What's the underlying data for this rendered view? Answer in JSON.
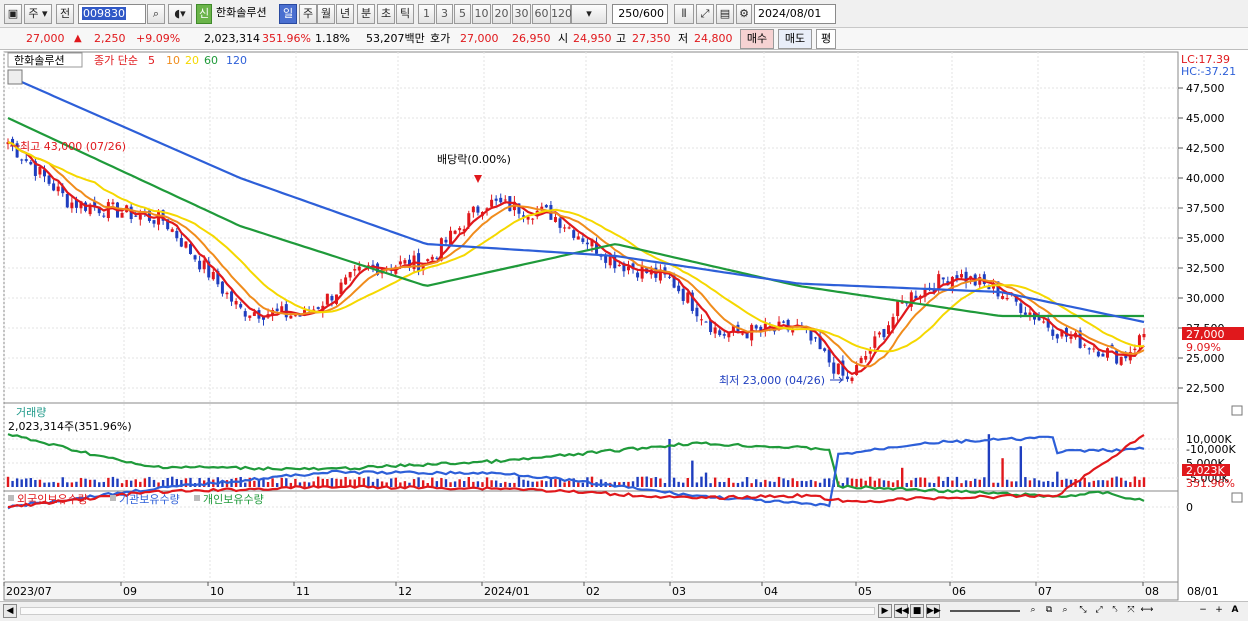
{
  "toolbar": {
    "period_type": "주",
    "prev_label": "전",
    "stock_code": "009830",
    "new_badge": "신",
    "stock_name": "한화솔루션",
    "periods": [
      "일",
      "주",
      "월",
      "년",
      "분",
      "초",
      "틱"
    ],
    "active_period": "일",
    "ranges": [
      "1",
      "3",
      "5",
      "10",
      "20",
      "30",
      "60",
      "120"
    ],
    "count_display": "250/600",
    "date": "2024/08/01"
  },
  "quote": {
    "price": "27,000",
    "arrow": "▲",
    "change": "2,250",
    "change_pct": "+9.09%",
    "volume": "2,023,314",
    "volume_ratio": "351.96%",
    "turnover": "1.18%",
    "amount": "53,207백만",
    "bid_label": "호가",
    "ask": "27,000",
    "bid": "26,950",
    "open_label": "시",
    "open": "24,950",
    "high_label": "고",
    "high": "27,350",
    "low_label": "저",
    "low": "24,800",
    "buy_label": "매수",
    "sell_label": "매도",
    "eval_label": "평"
  },
  "price_panel": {
    "legend_name": "한화솔루션",
    "legend_type": "종가 단순",
    "ma_labels": [
      "5",
      "10",
      "20",
      "60",
      "120"
    ],
    "ma_colors": [
      "#e0181c",
      "#f08c1c",
      "#f5d800",
      "#1f9a3a",
      "#2d5fd8"
    ],
    "lc": "LC:17.39",
    "hc": "HC:-37.21",
    "yaxis": [
      "47,500",
      "45,000",
      "42,500",
      "40,000",
      "37,500",
      "35,000",
      "32,500",
      "30,000",
      "27,500",
      "25,000",
      "22,500"
    ],
    "current_price_tag": "27,000",
    "current_pct_tag": "9.09%",
    "high_annotation": "최고 43,000 (07/26)",
    "low_annotation": "최저 23,000 (04/26)",
    "dividend_annotation": "배당락(0.00%)"
  },
  "volume_panel": {
    "title": "거래량",
    "value_text": "2,023,314주(351.96%)",
    "yaxis": [
      "10,000K",
      "5,000K"
    ],
    "current_tag": "2,023K",
    "pct_tag": "351.96%"
  },
  "holding_panel": {
    "legend": [
      "외국인보유수량",
      "기관보유수량",
      "개인보유수량"
    ],
    "legend_colors": [
      "#e0181c",
      "#2d5fd8",
      "#1f9a3a"
    ],
    "yaxis": [
      "0",
      "-5,000K",
      "-10,000K"
    ]
  },
  "xaxis": [
    "2023/07",
    "09",
    "10",
    "11",
    "12",
    "2024/01",
    "02",
    "03",
    "04",
    "05",
    "06",
    "07",
    "08",
    "08/01"
  ],
  "chart_data": {
    "type": "line",
    "title": "",
    "series": [
      {
        "name": "종가",
        "x": [
          "2023/07/26",
          "2023/08/15",
          "2023/09/15",
          "2023/10/10",
          "2023/10/31",
          "2023/11/20",
          "2023/12/10",
          "2023/12/29",
          "2024/01/20",
          "2024/02/10",
          "2024/02/28",
          "2024/03/15",
          "2024/04/10",
          "2024/04/26",
          "2024/05/15",
          "2024/05/31",
          "2024/06/15",
          "2024/07/05",
          "2024/07/25",
          "2024/08/01"
        ],
        "values": [
          43000,
          38000,
          36500,
          29000,
          28500,
          32500,
          33000,
          38000,
          37000,
          33000,
          31500,
          27000,
          27500,
          23000,
          30000,
          32000,
          30500,
          27000,
          25000,
          27000
        ]
      },
      {
        "name": "120",
        "x": [
          "2023/07/26",
          "2023/10/10",
          "2023/12/10",
          "2024/02/10",
          "2024/04/10",
          "2024/06/15",
          "2024/08/01"
        ],
        "values": [
          48500,
          40000,
          34500,
          33500,
          31200,
          30500,
          28000
        ]
      },
      {
        "name": "60",
        "x": [
          "2023/07/26",
          "2023/10/10",
          "2023/12/10",
          "2024/02/10",
          "2024/04/10",
          "2024/06/15",
          "2024/08/01"
        ],
        "values": [
          45000,
          36000,
          31000,
          34500,
          31000,
          28500,
          28500
        ]
      }
    ],
    "ylim": [
      21500,
      49500
    ]
  }
}
